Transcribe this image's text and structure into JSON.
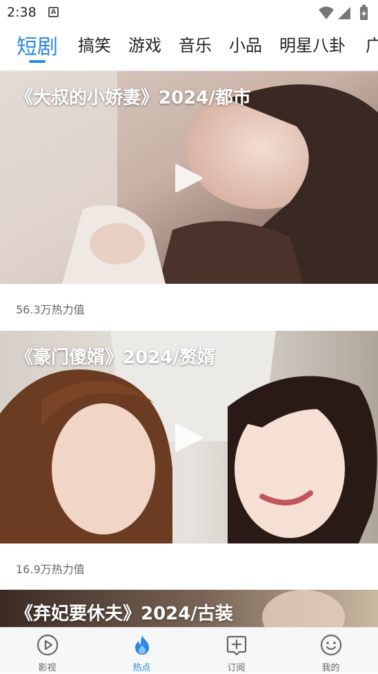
{
  "status_bar": {
    "time": "2:38",
    "notification_glyph": "A"
  },
  "tabs": [
    {
      "label": "短剧",
      "active": true
    },
    {
      "label": "搞笑"
    },
    {
      "label": "游戏"
    },
    {
      "label": "音乐"
    },
    {
      "label": "小品"
    },
    {
      "label": "明星八卦"
    },
    {
      "label": "广"
    }
  ],
  "feed": [
    {
      "title": "《大叔的小娇妻》2024/都市",
      "heat": "56.3万热力值"
    },
    {
      "title": "《豪门傻婿》2024/赘婿",
      "heat": "16.9万热力值"
    },
    {
      "title": "《弃妃要休夫》2024/古装"
    }
  ],
  "bottom_nav": [
    {
      "label": "影视",
      "icon": "play-circle-icon"
    },
    {
      "label": "热点",
      "icon": "flame-icon",
      "active": true
    },
    {
      "label": "订阅",
      "icon": "subscribe-icon"
    },
    {
      "label": "我的",
      "icon": "smiley-icon"
    }
  ],
  "colors": {
    "accent": "#2b87e3",
    "text": "#222222",
    "meta": "#666666"
  }
}
